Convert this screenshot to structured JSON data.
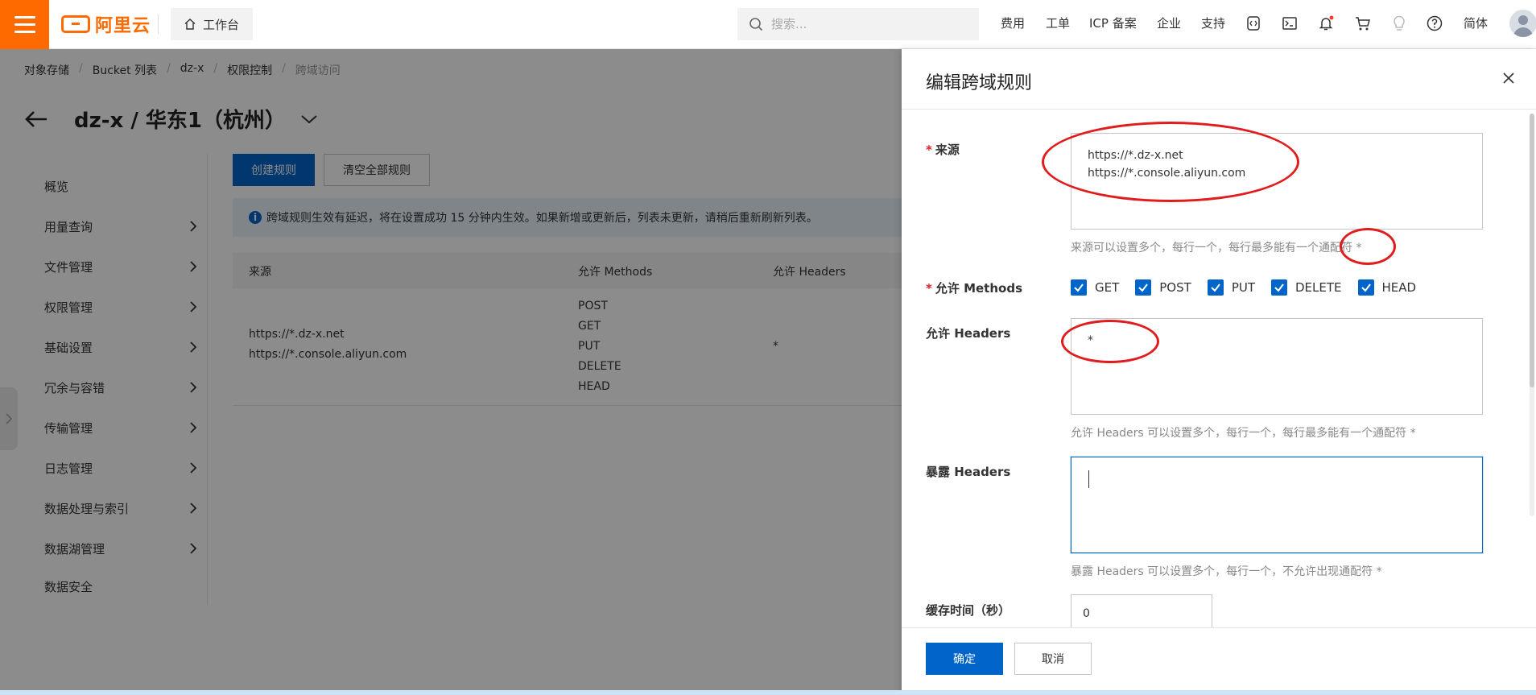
{
  "topbar": {
    "logo_text": "阿里云",
    "workbench": "工作台",
    "search_placeholder": "搜索...",
    "nav": [
      "费用",
      "工单",
      "ICP 备案",
      "企业",
      "支持"
    ],
    "lang": "简体",
    "brand_color": "#ff6a00"
  },
  "breadcrumb": [
    "对象存储",
    "Bucket 列表",
    "dz-x",
    "权限控制",
    "跨域访问"
  ],
  "page_title": "dz-x / 华东1（杭州）",
  "sidenav": [
    {
      "label": "概览"
    },
    {
      "label": "用量查询"
    },
    {
      "label": "文件管理"
    },
    {
      "label": "权限管理"
    },
    {
      "label": "基础设置"
    },
    {
      "label": "冗余与容错"
    },
    {
      "label": "传输管理"
    },
    {
      "label": "日志管理"
    },
    {
      "label": "数据处理与索引"
    },
    {
      "label": "数据湖管理"
    },
    {
      "label": "数据安全"
    }
  ],
  "actions": {
    "create": "创建规则",
    "clear": "清空全部规则"
  },
  "notice": "跨域规则生效有延迟，将在设置成功 15 分钟内生效。如果新增或更新后，列表未更新，请稍后重新刷新列表。",
  "table": {
    "headers": [
      "来源",
      "允许 Methods",
      "允许 Headers"
    ],
    "row": {
      "origins": [
        "https://*.dz-x.net",
        "https://*.console.aliyun.com"
      ],
      "methods": [
        "POST",
        "GET",
        "PUT",
        "DELETE",
        "HEAD"
      ],
      "headers": "*"
    }
  },
  "drawer": {
    "title": "编辑跨域规则",
    "origin_label": "来源",
    "origin_value": "https://*.dz-x.net\nhttps://*.console.aliyun.com",
    "origin_hint": "来源可以设置多个，每行一个，每行最多能有一个通配符 *",
    "methods_label": "允许 Methods",
    "methods": [
      {
        "label": "GET",
        "checked": true
      },
      {
        "label": "POST",
        "checked": true
      },
      {
        "label": "PUT",
        "checked": true
      },
      {
        "label": "DELETE",
        "checked": true
      },
      {
        "label": "HEAD",
        "checked": true
      }
    ],
    "allow_headers_label": "允许 Headers",
    "allow_headers_value": "*",
    "allow_headers_hint": "允许 Headers 可以设置多个，每行一个，每行最多能有一个通配符 *",
    "expose_headers_label": "暴露 Headers",
    "expose_headers_value": "",
    "expose_headers_hint": "暴露 Headers 可以设置多个，每行一个，不允许出现通配符 *",
    "cache_label": "缓存时间（秒）",
    "cache_value": "0",
    "ok": "确定",
    "cancel": "取消",
    "accent_color": "#0064c8"
  }
}
